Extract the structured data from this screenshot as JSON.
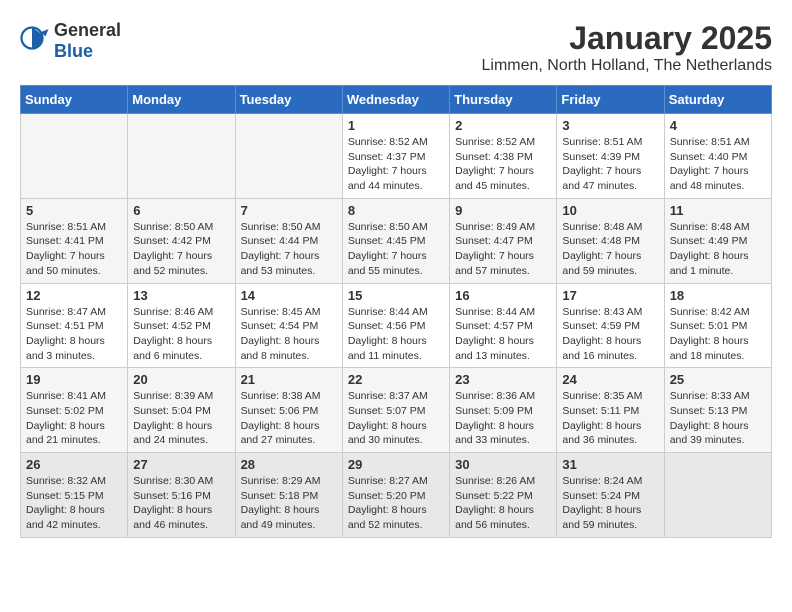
{
  "header": {
    "logo": {
      "general": "General",
      "blue": "Blue"
    },
    "title": "January 2025",
    "location": "Limmen, North Holland, The Netherlands"
  },
  "calendar": {
    "weekdays": [
      "Sunday",
      "Monday",
      "Tuesday",
      "Wednesday",
      "Thursday",
      "Friday",
      "Saturday"
    ],
    "weeks": [
      [
        {
          "day": "",
          "info": ""
        },
        {
          "day": "",
          "info": ""
        },
        {
          "day": "",
          "info": ""
        },
        {
          "day": "1",
          "info": "Sunrise: 8:52 AM\nSunset: 4:37 PM\nDaylight: 7 hours\nand 44 minutes."
        },
        {
          "day": "2",
          "info": "Sunrise: 8:52 AM\nSunset: 4:38 PM\nDaylight: 7 hours\nand 45 minutes."
        },
        {
          "day": "3",
          "info": "Sunrise: 8:51 AM\nSunset: 4:39 PM\nDaylight: 7 hours\nand 47 minutes."
        },
        {
          "day": "4",
          "info": "Sunrise: 8:51 AM\nSunset: 4:40 PM\nDaylight: 7 hours\nand 48 minutes."
        }
      ],
      [
        {
          "day": "5",
          "info": "Sunrise: 8:51 AM\nSunset: 4:41 PM\nDaylight: 7 hours\nand 50 minutes."
        },
        {
          "day": "6",
          "info": "Sunrise: 8:50 AM\nSunset: 4:42 PM\nDaylight: 7 hours\nand 52 minutes."
        },
        {
          "day": "7",
          "info": "Sunrise: 8:50 AM\nSunset: 4:44 PM\nDaylight: 7 hours\nand 53 minutes."
        },
        {
          "day": "8",
          "info": "Sunrise: 8:50 AM\nSunset: 4:45 PM\nDaylight: 7 hours\nand 55 minutes."
        },
        {
          "day": "9",
          "info": "Sunrise: 8:49 AM\nSunset: 4:47 PM\nDaylight: 7 hours\nand 57 minutes."
        },
        {
          "day": "10",
          "info": "Sunrise: 8:48 AM\nSunset: 4:48 PM\nDaylight: 7 hours\nand 59 minutes."
        },
        {
          "day": "11",
          "info": "Sunrise: 8:48 AM\nSunset: 4:49 PM\nDaylight: 8 hours\nand 1 minute."
        }
      ],
      [
        {
          "day": "12",
          "info": "Sunrise: 8:47 AM\nSunset: 4:51 PM\nDaylight: 8 hours\nand 3 minutes."
        },
        {
          "day": "13",
          "info": "Sunrise: 8:46 AM\nSunset: 4:52 PM\nDaylight: 8 hours\nand 6 minutes."
        },
        {
          "day": "14",
          "info": "Sunrise: 8:45 AM\nSunset: 4:54 PM\nDaylight: 8 hours\nand 8 minutes."
        },
        {
          "day": "15",
          "info": "Sunrise: 8:44 AM\nSunset: 4:56 PM\nDaylight: 8 hours\nand 11 minutes."
        },
        {
          "day": "16",
          "info": "Sunrise: 8:44 AM\nSunset: 4:57 PM\nDaylight: 8 hours\nand 13 minutes."
        },
        {
          "day": "17",
          "info": "Sunrise: 8:43 AM\nSunset: 4:59 PM\nDaylight: 8 hours\nand 16 minutes."
        },
        {
          "day": "18",
          "info": "Sunrise: 8:42 AM\nSunset: 5:01 PM\nDaylight: 8 hours\nand 18 minutes."
        }
      ],
      [
        {
          "day": "19",
          "info": "Sunrise: 8:41 AM\nSunset: 5:02 PM\nDaylight: 8 hours\nand 21 minutes."
        },
        {
          "day": "20",
          "info": "Sunrise: 8:39 AM\nSunset: 5:04 PM\nDaylight: 8 hours\nand 24 minutes."
        },
        {
          "day": "21",
          "info": "Sunrise: 8:38 AM\nSunset: 5:06 PM\nDaylight: 8 hours\nand 27 minutes."
        },
        {
          "day": "22",
          "info": "Sunrise: 8:37 AM\nSunset: 5:07 PM\nDaylight: 8 hours\nand 30 minutes."
        },
        {
          "day": "23",
          "info": "Sunrise: 8:36 AM\nSunset: 5:09 PM\nDaylight: 8 hours\nand 33 minutes."
        },
        {
          "day": "24",
          "info": "Sunrise: 8:35 AM\nSunset: 5:11 PM\nDaylight: 8 hours\nand 36 minutes."
        },
        {
          "day": "25",
          "info": "Sunrise: 8:33 AM\nSunset: 5:13 PM\nDaylight: 8 hours\nand 39 minutes."
        }
      ],
      [
        {
          "day": "26",
          "info": "Sunrise: 8:32 AM\nSunset: 5:15 PM\nDaylight: 8 hours\nand 42 minutes."
        },
        {
          "day": "27",
          "info": "Sunrise: 8:30 AM\nSunset: 5:16 PM\nDaylight: 8 hours\nand 46 minutes."
        },
        {
          "day": "28",
          "info": "Sunrise: 8:29 AM\nSunset: 5:18 PM\nDaylight: 8 hours\nand 49 minutes."
        },
        {
          "day": "29",
          "info": "Sunrise: 8:27 AM\nSunset: 5:20 PM\nDaylight: 8 hours\nand 52 minutes."
        },
        {
          "day": "30",
          "info": "Sunrise: 8:26 AM\nSunset: 5:22 PM\nDaylight: 8 hours\nand 56 minutes."
        },
        {
          "day": "31",
          "info": "Sunrise: 8:24 AM\nSunset: 5:24 PM\nDaylight: 8 hours\nand 59 minutes."
        },
        {
          "day": "",
          "info": ""
        }
      ]
    ]
  }
}
